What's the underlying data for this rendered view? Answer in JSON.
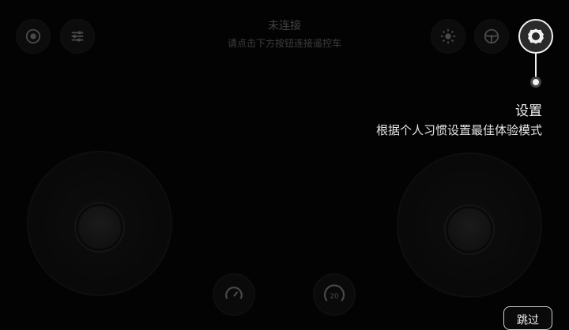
{
  "status": {
    "title": "未连接",
    "subtitle": "请点击下方按钮连接遥控车"
  },
  "guide": {
    "title": "设置",
    "description": "根据个人习惯设置最佳体验模式"
  },
  "skip_label": "跳过",
  "speed_dial": {
    "value": "20"
  },
  "colors": {
    "background": "#030303",
    "highlight": "#f2f2f2"
  },
  "icons": {
    "top_left_1": "record-icon",
    "top_left_2": "sliders-icon",
    "top_right_1": "brightness-icon",
    "top_right_2": "steering-wheel-icon",
    "settings": "gear-icon"
  }
}
